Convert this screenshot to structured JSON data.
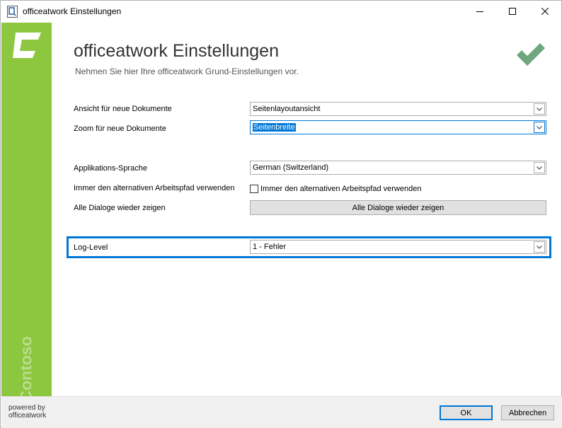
{
  "window": {
    "title": "officeatwork Einstellungen"
  },
  "header": {
    "title": "officeatwork Einstellungen",
    "subtitle": "Nehmen Sie hier Ihre officeatwork Grund-Einstellungen vor."
  },
  "sidebar": {
    "brand_text": "Contoso"
  },
  "settings": {
    "view_label": "Ansicht für neue Dokumente",
    "view_value": "Seitenlayoutansicht",
    "zoom_label": "Zoom für neue Dokumente",
    "zoom_value": "Seitenbreite",
    "language_label": "Applikations-Sprache",
    "language_value": "German (Switzerland)",
    "alt_path_label": "Immer den alternativen Arbeitspfad verwenden",
    "alt_path_checkbox_label": "Immer den alternativen Arbeitspfad verwenden",
    "alt_path_checked": false,
    "dialogs_label": "Alle Dialoge wieder zeigen",
    "dialogs_button": "Alle Dialoge wieder zeigen",
    "loglevel_label": "Log-Level",
    "loglevel_value": "1 - Fehler"
  },
  "footer": {
    "powered_line1": "powered by",
    "powered_line2": "officeatwork",
    "ok_label": "OK",
    "cancel_label": "Abbrechen"
  },
  "colors": {
    "sidebar_green": "#8dc63f",
    "checkmark_green": "#6ea77e",
    "accent_blue": "#0078d7"
  },
  "icons": [
    "app-icon",
    "minimize-icon",
    "maximize-icon",
    "close-icon",
    "logo-icon",
    "checkmark-icon",
    "chevron-down-icon"
  ]
}
